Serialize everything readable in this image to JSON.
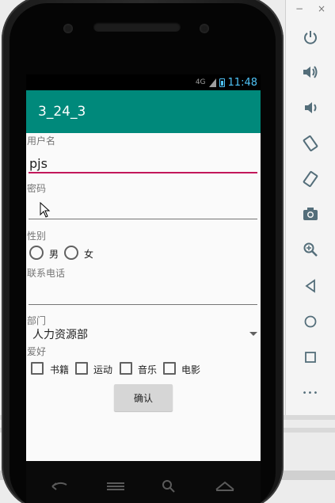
{
  "emulator": {
    "window_controls": [
      "−",
      "×"
    ],
    "side_buttons": [
      "power-icon",
      "volume-up-icon",
      "volume-down-icon",
      "rotate-left-icon",
      "rotate-right-icon",
      "camera-icon",
      "zoom-icon",
      "back-icon",
      "home-icon",
      "overview-icon",
      "more-icon"
    ],
    "more_label": "•••"
  },
  "statusbar": {
    "signal": "4G",
    "time": "11:48"
  },
  "app": {
    "title": "3_24_3"
  },
  "form": {
    "username_label": "用户名",
    "username_value": "pjs",
    "password_label": "密码",
    "password_value": "",
    "gender_label": "性别",
    "gender_options": [
      "男",
      "女"
    ],
    "phone_label": "联系电话",
    "phone_value": "",
    "department_label": "部门",
    "department_value": "人力资源部",
    "hobby_label": "爱好",
    "hobby_options": [
      "书籍",
      "运动",
      "音乐",
      "电影"
    ],
    "confirm_label": "确认"
  },
  "colors": {
    "appbar": "#00897b",
    "focus_underline": "#c2185b",
    "status_accent": "#4fc3f7"
  }
}
